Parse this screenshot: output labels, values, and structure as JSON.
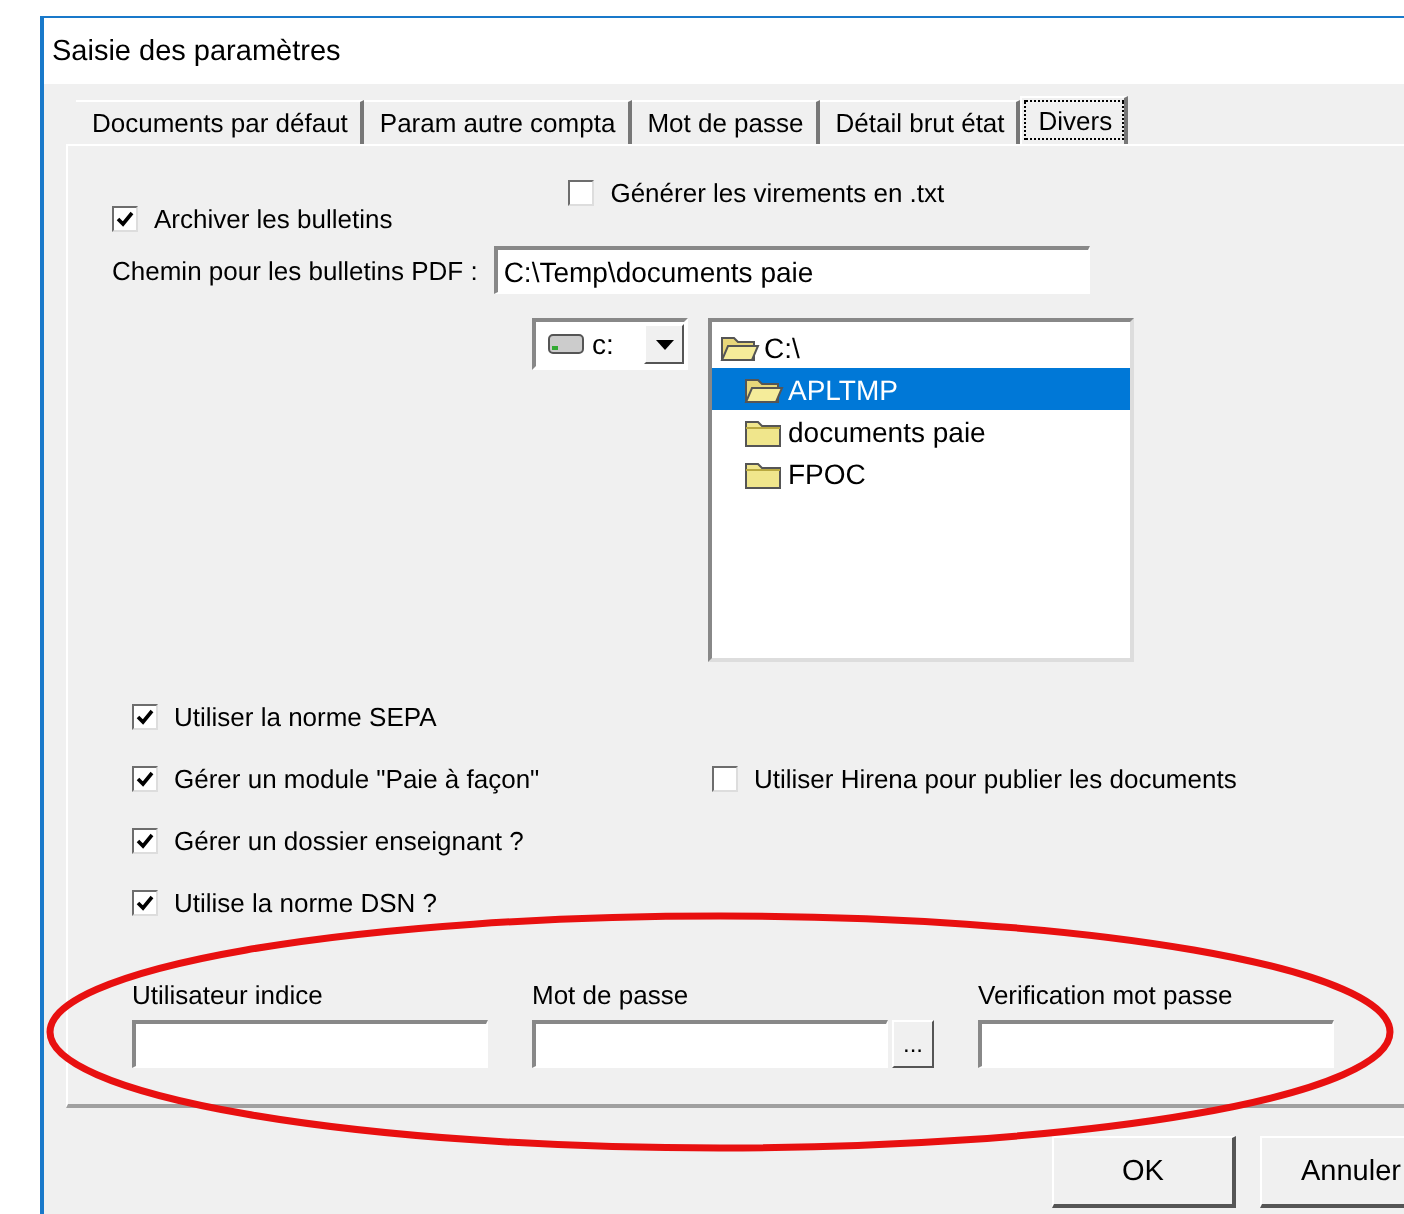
{
  "window": {
    "title": "Saisie des paramètres"
  },
  "tabs": [
    {
      "label": "Documents par défaut",
      "selected": false
    },
    {
      "label": "Param autre compta",
      "selected": false
    },
    {
      "label": "Mot de passe",
      "selected": false
    },
    {
      "label": "Détail brut état",
      "selected": false
    },
    {
      "label": "Divers",
      "selected": true
    }
  ],
  "options_top": [
    {
      "label": "Archiver les bulletins",
      "checked": true
    },
    {
      "label": "Générer les virements en .txt",
      "checked": false
    }
  ],
  "pdf_path": {
    "label": "Chemin pour les bulletins PDF :",
    "value": "C:\\Temp\\documents paie"
  },
  "drive": {
    "value": "c:"
  },
  "folders": [
    {
      "name": "C:\\",
      "open": true,
      "selected": false
    },
    {
      "name": "APLTMP",
      "open": true,
      "selected": true
    },
    {
      "name": "documents paie",
      "open": false,
      "selected": false
    },
    {
      "name": "FPOC",
      "open": false,
      "selected": false
    }
  ],
  "options": [
    [
      {
        "label": "Utiliser la norme SEPA",
        "checked": true
      }
    ],
    [
      {
        "label": "Gérer un module \"Paie à façon\"",
        "checked": true
      },
      {
        "label": "Utiliser Hirena pour publier les documents",
        "checked": false
      }
    ],
    [
      {
        "label": "Gérer un dossier enseignant ?",
        "checked": true
      }
    ],
    [
      {
        "label": "Utilise la norme DSN ?",
        "checked": true
      }
    ]
  ],
  "credentials": [
    {
      "label": "Utilisateur indice"
    },
    {
      "label": "Mot de passe",
      "browse": "..."
    },
    {
      "label": "Verification mot passe"
    }
  ],
  "buttons": [
    "OK",
    "Annuler"
  ]
}
